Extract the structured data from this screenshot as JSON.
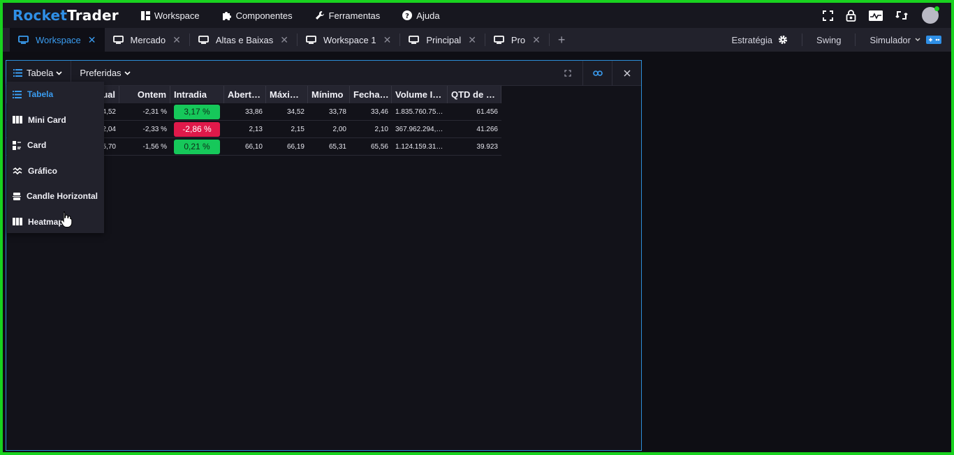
{
  "app": {
    "logo_part1": "Rocket",
    "logo_part2": "Trader",
    "colors": {
      "accent": "#2f8fe6",
      "up": "#16c85a",
      "down": "#e0194a",
      "frame": "#19d21f"
    }
  },
  "menu": [
    {
      "label": "Workspace",
      "icon": "grid-icon"
    },
    {
      "label": "Componentes",
      "icon": "puzzle-icon"
    },
    {
      "label": "Ferramentas",
      "icon": "wrench-icon"
    },
    {
      "label": "Ajuda",
      "icon": "help-icon"
    }
  ],
  "top_icons": [
    "fullscreen-icon",
    "lock-icon",
    "activity-icon",
    "sync-icon",
    "avatar"
  ],
  "tabs": [
    {
      "label": "Workspace",
      "active": true
    },
    {
      "label": "Mercado"
    },
    {
      "label": "Altas e Baixas"
    },
    {
      "label": "Workspace 1"
    },
    {
      "label": "Principal"
    },
    {
      "label": "Pro"
    }
  ],
  "tab_right": {
    "strategy": "Estratégia",
    "mode": "Swing",
    "simulator": "Simulador"
  },
  "widget": {
    "view_label": "Tabela",
    "prefs_label": "Preferidas",
    "columns": [
      "ual",
      "Ontem",
      "Intradia",
      "Abert…",
      "Máxi…",
      "Mínimo",
      "Fecha…",
      "Volume I…",
      "QTD de …"
    ],
    "rows": [
      {
        "atual": "4,52",
        "ontem": "-2,31 %",
        "intradia": "3,17 %",
        "dir": "up",
        "abertura": "33,86",
        "maxima": "34,52",
        "minimo": "33,78",
        "fechamento": "33,46",
        "volume": "1.835.760.75…",
        "qtd": "61.456"
      },
      {
        "atual": "2,04",
        "ontem": "-2,33 %",
        "intradia": "-2,86 %",
        "dir": "down",
        "abertura": "2,13",
        "maxima": "2,15",
        "minimo": "2,00",
        "fechamento": "2,10",
        "volume": "367.962.294,…",
        "qtd": "41.266"
      },
      {
        "atual": "5,70",
        "ontem": "-1,56 %",
        "intradia": "0,21 %",
        "dir": "up",
        "abertura": "66,10",
        "maxima": "66,19",
        "minimo": "65,31",
        "fechamento": "65,56",
        "volume": "1.124.159.31…",
        "qtd": "39.923"
      }
    ]
  },
  "dropdown": [
    {
      "label": "Tabela",
      "selected": true
    },
    {
      "label": "Mini Card"
    },
    {
      "label": "Card"
    },
    {
      "label": "Gráfico"
    },
    {
      "label": "Candle Horizontal"
    },
    {
      "label": "Heatmap"
    }
  ]
}
